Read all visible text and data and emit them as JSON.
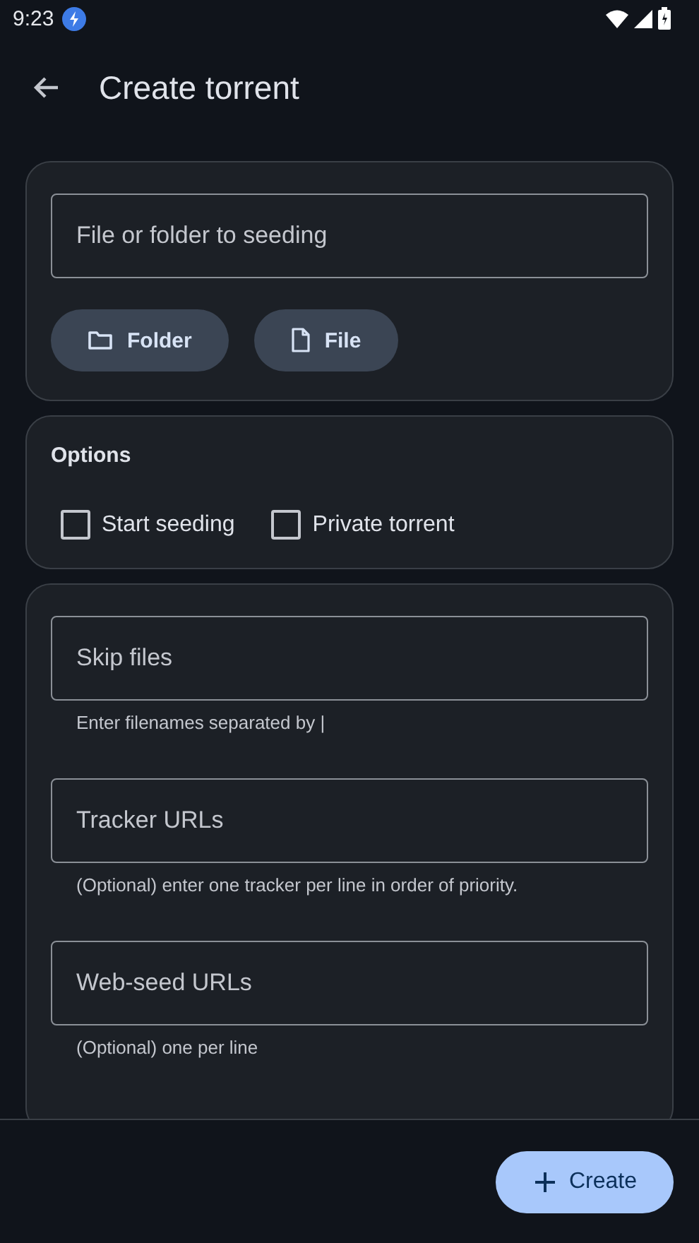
{
  "status_bar": {
    "time": "9:23"
  },
  "app_bar": {
    "title": "Create torrent"
  },
  "source": {
    "placeholder": "File or folder to seeding",
    "buttons": [
      {
        "label": "Folder",
        "kind": "folder"
      },
      {
        "label": "File",
        "kind": "file"
      }
    ]
  },
  "options": {
    "title": "Options",
    "checkboxes": [
      {
        "label": "Start seeding",
        "checked": false
      },
      {
        "label": "Private torrent",
        "checked": false
      }
    ]
  },
  "fields": [
    {
      "placeholder": "Skip files",
      "helper": "Enter filenames separated by |"
    },
    {
      "placeholder": "Tracker URLs",
      "helper": "(Optional) enter one tracker per line in order of priority."
    },
    {
      "placeholder": "Web-seed URLs",
      "helper": "(Optional) one per line"
    }
  ],
  "create_button": {
    "label": "Create"
  }
}
